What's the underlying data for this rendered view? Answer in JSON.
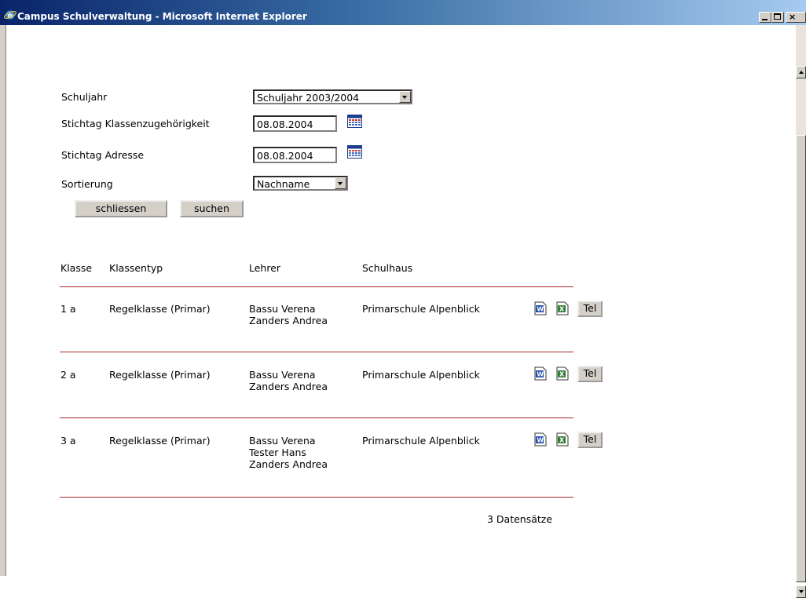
{
  "window": {
    "title": "Campus Schulverwaltung - Microsoft Internet Explorer",
    "close_glyph": "×"
  },
  "form": {
    "schuljahr_label": "Schuljahr",
    "schuljahr_value": "Schuljahr 2003/2004",
    "stichtag_klasse_label": "Stichtag Klassenzugehörigkeit",
    "stichtag_klasse_value": "08.08.2004",
    "stichtag_adresse_label": "Stichtag Adresse",
    "stichtag_adresse_value": "08.08.2004",
    "sortierung_label": "Sortierung",
    "sortierung_value": "Nachname",
    "close_button": "schliessen",
    "search_button": "suchen"
  },
  "table": {
    "headers": [
      "Klasse",
      "Klassentyp",
      "Lehrer",
      "Schulhaus"
    ],
    "rows": [
      {
        "klasse": "1 a",
        "klassentyp": "Regelklasse (Primar)",
        "lehrer": [
          "Bassu Verena",
          "Zanders Andrea"
        ],
        "schulhaus": "Primarschule Alpenblick",
        "tel": "Tel"
      },
      {
        "klasse": "2 a",
        "klassentyp": "Regelklasse (Primar)",
        "lehrer": [
          "Bassu Verena",
          "Zanders Andrea"
        ],
        "schulhaus": "Primarschule Alpenblick",
        "tel": "Tel"
      },
      {
        "klasse": "3 a",
        "klassentyp": "Regelklasse (Primar)",
        "lehrer": [
          "Bassu Verena",
          "Tester Hans",
          "Zanders Andrea"
        ],
        "schulhaus": "Primarschule Alpenblick",
        "tel": "Tel"
      }
    ],
    "record_count": "3 Datensätze"
  },
  "icons": {
    "title": "ie-icon",
    "calendar": "calendar-icon",
    "word": "word-icon",
    "excel": "excel-icon"
  },
  "colors": {
    "titlebar_start": "#0a246a",
    "titlebar_end": "#a6caf0",
    "divider": "#a52a2a",
    "button_face": "#d4d0c8"
  }
}
